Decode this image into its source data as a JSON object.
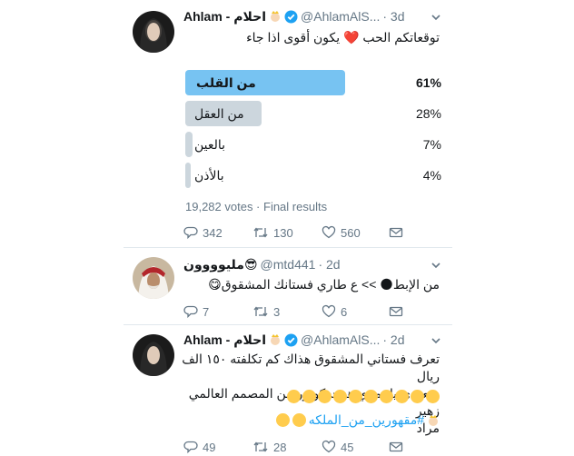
{
  "tweet1": {
    "author_name": "Ahlam - احلام",
    "author_handle": "@AhlamAlS...",
    "time": "· 3d",
    "text": "توقعاتكم الحب ❤️ يكون أقوى اذا جاء",
    "poll": {
      "options": [
        {
          "label": "من القلب",
          "percent_text": "61%",
          "percent": 61,
          "winner": true
        },
        {
          "label": "من العقل",
          "percent_text": "28%",
          "percent": 28,
          "winner": false
        },
        {
          "label": "بالعين",
          "percent_text": "7%",
          "percent": 7,
          "winner": false
        },
        {
          "label": "بالأذن",
          "percent_text": "4%",
          "percent": 4,
          "winner": false
        }
      ],
      "meta": "19,282 votes · Final results",
      "colors": {
        "winner": "#77c3f2",
        "other": "#ccd6dd"
      }
    },
    "actions": {
      "replies": "342",
      "retweets": "130",
      "likes": "560"
    }
  },
  "tweet2": {
    "author_name": "مليوووون😎",
    "author_handle": "@mtd441",
    "time": "· 2d",
    "text": "من الإبط🌑 >> ع طاري فستانك المشقوق😋",
    "actions": {
      "replies": "7",
      "retweets": "3",
      "likes": "6"
    }
  },
  "tweet3": {
    "author_name": "Ahlam - احلام",
    "author_handle": "@AhlamAlS...",
    "time": "· 2d",
    "text_lines": [
      "تعرف فستاني المشقوق هذاك كم تكلفته ١٥٠ الف ريال",
      "سعودي ياعمري هوت كوتور من المصمم العالمي زهير",
      "مراد"
    ],
    "hashtag": "#مقهورين_من_الملكه",
    "actions": {
      "replies": "49",
      "retweets": "28",
      "likes": "45"
    }
  },
  "colors": {
    "accent": "#1da1f2",
    "muted": "#657786",
    "text": "#14171a"
  },
  "icons": [
    "verified-badge-icon",
    "chevron-down-icon",
    "reply-icon",
    "retweet-icon",
    "like-icon",
    "dm-icon"
  ]
}
